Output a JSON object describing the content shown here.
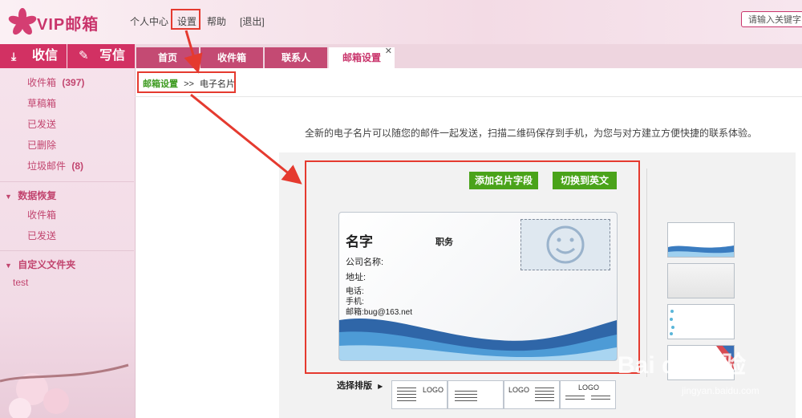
{
  "brand": {
    "name": "VIP邮箱"
  },
  "top_nav": {
    "profile": "个人中心",
    "settings": "设置",
    "help": "帮助",
    "logout": "[退出]"
  },
  "search": {
    "placeholder": "请输入关键字"
  },
  "actions": {
    "inbox": "收信",
    "compose": "写信"
  },
  "tabs": [
    {
      "label": "首页"
    },
    {
      "label": "收件箱"
    },
    {
      "label": "联系人"
    },
    {
      "label": "邮箱设置"
    }
  ],
  "sidebar": {
    "folders": [
      {
        "label": "收件箱",
        "count": "(397)"
      },
      {
        "label": "草稿箱"
      },
      {
        "label": "已发送"
      },
      {
        "label": "已删除"
      },
      {
        "label": "垃圾邮件",
        "count": "(8)"
      }
    ],
    "recovery": {
      "title": "数据恢复",
      "items": [
        "收件箱",
        "已发送"
      ]
    },
    "custom": {
      "title": "自定义文件夹",
      "items": [
        "test"
      ]
    }
  },
  "breadcrumb": {
    "parent": "邮箱设置",
    "sep": ">>",
    "current": "电子名片"
  },
  "intro_text": "全新的电子名片可以随您的邮件一起发送，扫描二维码保存到手机，为您与对方建立方便快捷的联系体验。",
  "card_actions": {
    "add_field": "添加名片字段",
    "switch_lang": "切换到英文"
  },
  "card": {
    "name": "名字",
    "title": "职务",
    "company": "公司名称:",
    "address": "地址:",
    "phone": "电话:",
    "mobile": "手机:",
    "email": "邮箱:bug@163.net"
  },
  "layout_label": "选择排版",
  "layout_logo": "LOGO",
  "watermark": {
    "main": "Bai du 经验",
    "sub": "jingyan.baidu.com"
  },
  "colors": {
    "brand": "#c9346b",
    "green": "#4aa31a",
    "annotation": "#e53a2f"
  }
}
